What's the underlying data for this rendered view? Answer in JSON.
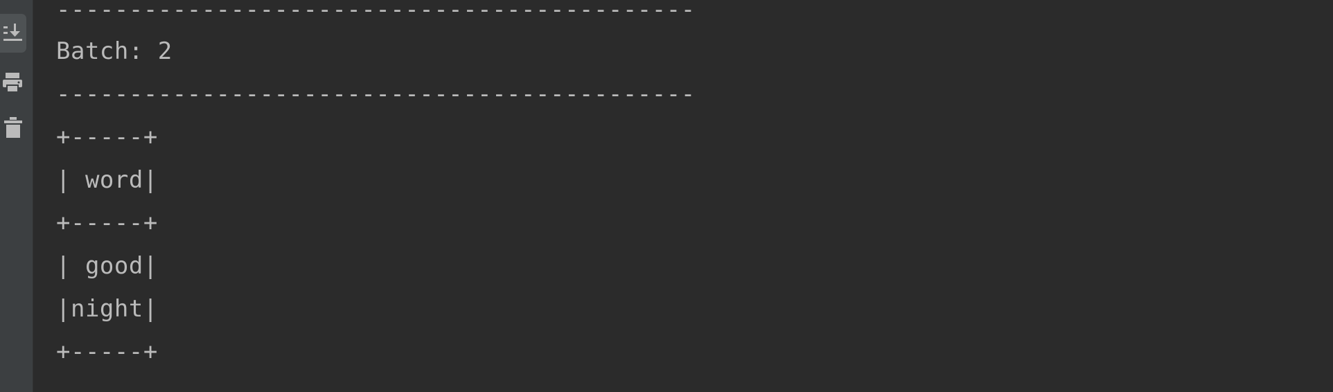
{
  "toolbar": {
    "icons": [
      "scroll-to-end-icon",
      "print-icon",
      "trash-icon"
    ]
  },
  "console": {
    "lines": [
      "--------------------------------------------",
      "Batch: 2",
      "--------------------------------------------",
      "+-----+",
      "| word|",
      "+-----+",
      "| good|",
      "|night|",
      "+-----+"
    ]
  },
  "colors": {
    "background": "#2b2b2b",
    "sidebar": "#3c3f41",
    "text": "#bbbbbb"
  }
}
